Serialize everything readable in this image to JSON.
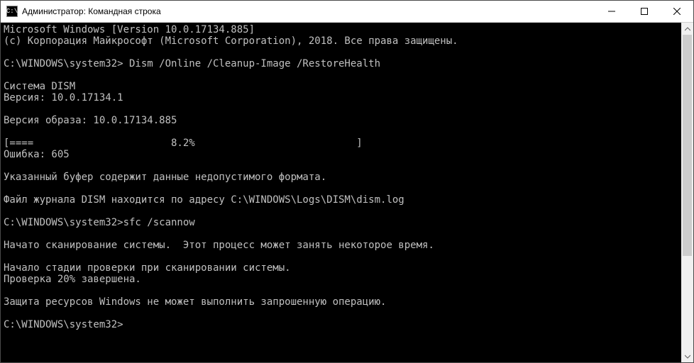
{
  "window": {
    "title": "Администратор: Командная строка",
    "icon_label": "C:\\"
  },
  "controls": {
    "minimize": "minimize",
    "maximize": "maximize",
    "close": "close"
  },
  "console": {
    "lines": [
      "Microsoft Windows [Version 10.0.17134.885]",
      "(c) Корпорация Майкрософт (Microsoft Corporation), 2018. Все права защищены.",
      "",
      "C:\\WINDOWS\\system32> Dism /Online /Cleanup-Image /RestoreHealth",
      "",
      "Cистема DISM",
      "Версия: 10.0.17134.1",
      "",
      "Версия образа: 10.0.17134.885",
      "",
      "[====                       8.2%                           ]",
      "Ошибка: 605",
      "",
      "Указанный буфер содержит данные недопустимого формата.",
      "",
      "Файл журнала DISM находится по адресу C:\\WINDOWS\\Logs\\DISM\\dism.log",
      "",
      "C:\\WINDOWS\\system32>sfc /scannow",
      "",
      "Начато сканирование системы.  Этот процесс может занять некоторое время.",
      "",
      "Начало стадии проверки при сканировании системы.",
      "Проверка 20% завершена.",
      "",
      "Защита ресурсов Windows не может выполнить запрошенную операцию.",
      "",
      "C:\\WINDOWS\\system32>"
    ]
  }
}
